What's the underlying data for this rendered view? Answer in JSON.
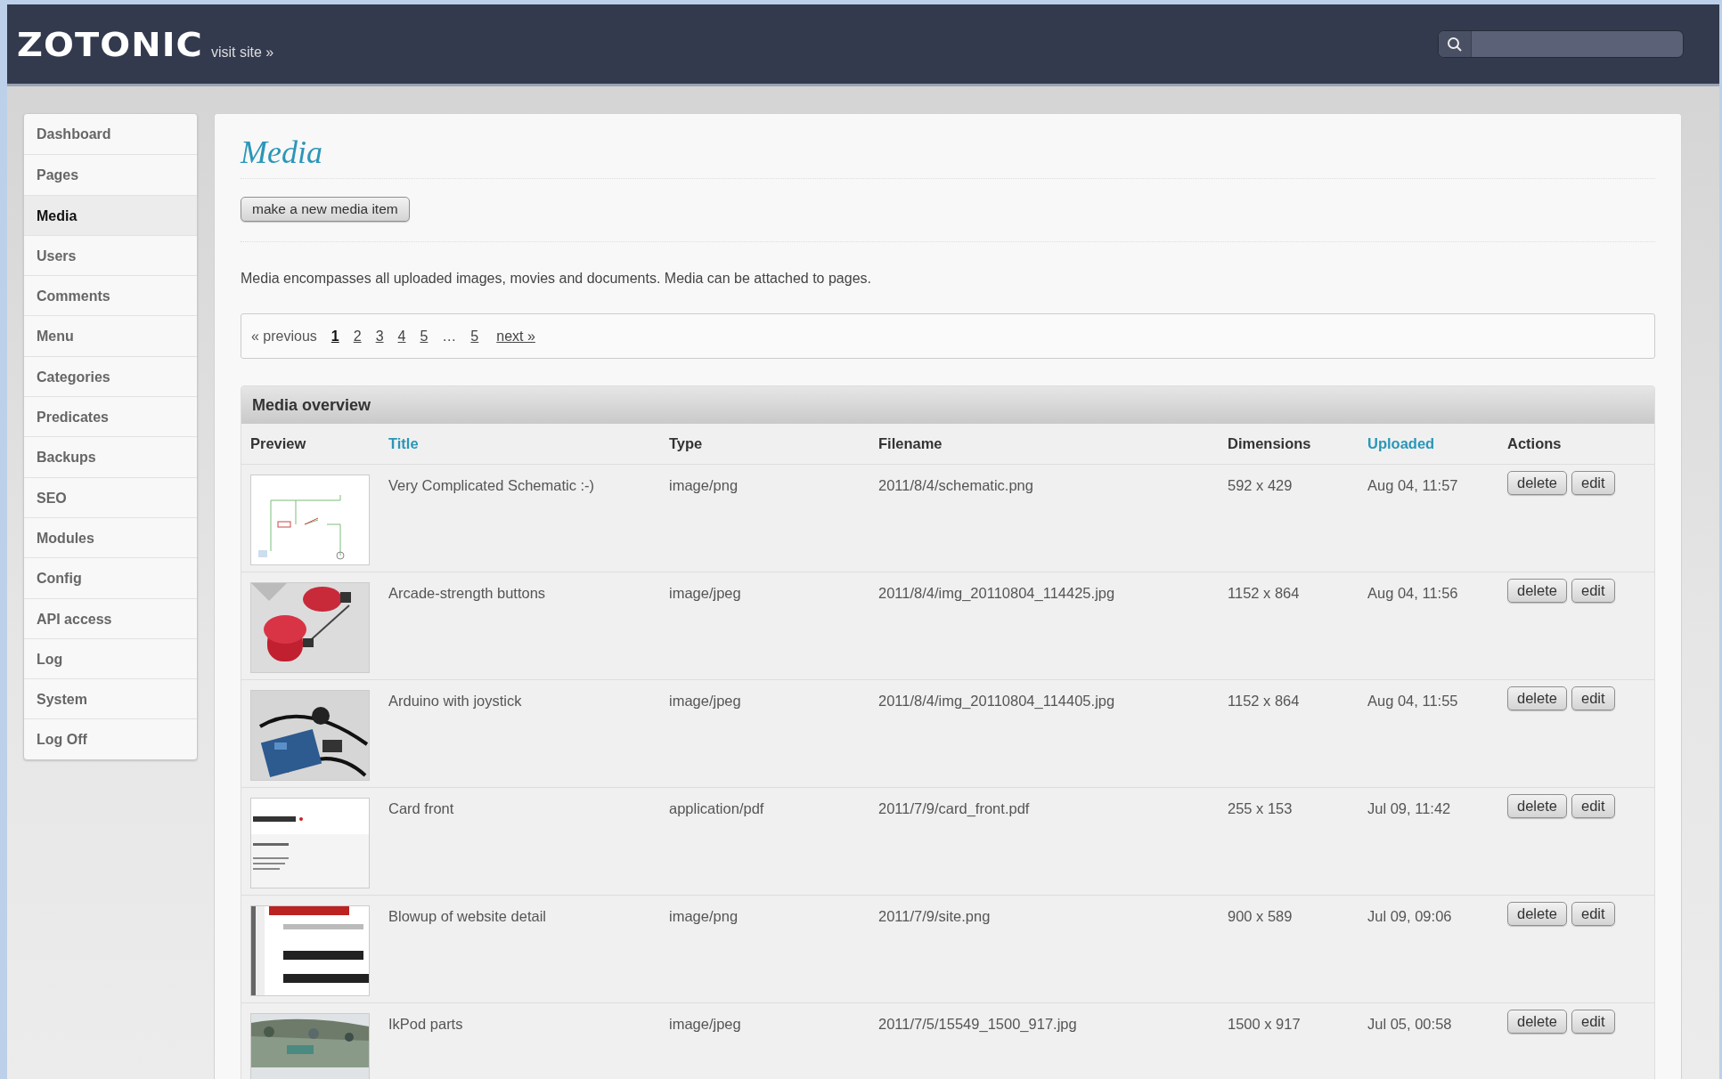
{
  "header": {
    "logo": "ZOTONIC",
    "visit_link": "visit site »"
  },
  "sidebar": {
    "items": [
      {
        "label": "Dashboard",
        "selected": false
      },
      {
        "label": "Pages",
        "selected": false
      },
      {
        "label": "Media",
        "selected": true
      },
      {
        "label": "Users",
        "selected": false
      },
      {
        "label": "Comments",
        "selected": false
      },
      {
        "label": "Menu",
        "selected": false
      },
      {
        "label": "Categories",
        "selected": false
      },
      {
        "label": "Predicates",
        "selected": false
      },
      {
        "label": "Backups",
        "selected": false
      },
      {
        "label": "SEO",
        "selected": false
      },
      {
        "label": "Modules",
        "selected": false
      },
      {
        "label": "Config",
        "selected": false
      },
      {
        "label": "API access",
        "selected": false
      },
      {
        "label": "Log",
        "selected": false
      },
      {
        "label": "System",
        "selected": false
      },
      {
        "label": "Log Off",
        "selected": false
      }
    ]
  },
  "page": {
    "title": "Media",
    "new_button": "make a new media item",
    "description": "Media encompasses all uploaded images, movies and documents. Media can be attached to pages."
  },
  "pagination": {
    "previous": {
      "label": "« previous",
      "disabled": true
    },
    "items": [
      {
        "kind": "page",
        "label": "1",
        "selected": true
      },
      {
        "kind": "page",
        "label": "2",
        "selected": false
      },
      {
        "kind": "page",
        "label": "3",
        "selected": false
      },
      {
        "kind": "page",
        "label": "4",
        "selected": false
      },
      {
        "kind": "page",
        "label": "5",
        "selected": false
      },
      {
        "kind": "ellipsis",
        "label": "…"
      },
      {
        "kind": "page",
        "label": "5",
        "selected": false
      }
    ],
    "next": {
      "label": "next »",
      "disabled": false
    }
  },
  "table": {
    "title": "Media overview",
    "columns": [
      {
        "label": "Preview",
        "sortable": false
      },
      {
        "label": "Title",
        "sortable": true
      },
      {
        "label": "Type",
        "sortable": false
      },
      {
        "label": "Filename",
        "sortable": false
      },
      {
        "label": "Dimensions",
        "sortable": false
      },
      {
        "label": "Uploaded",
        "sortable": true
      },
      {
        "label": "Actions",
        "sortable": false
      }
    ],
    "rows": [
      {
        "title": "Very Complicated Schematic :-)",
        "type": "image/png",
        "filename": "2011/8/4/schematic.png",
        "dimensions": "592 x 429",
        "uploaded": "Aug 04, 11:57",
        "actions": [
          "delete",
          "edit"
        ]
      },
      {
        "title": "Arcade-strength buttons",
        "type": "image/jpeg",
        "filename": "2011/8/4/img_20110804_114425.jpg",
        "dimensions": "1152 x 864",
        "uploaded": "Aug 04, 11:56",
        "actions": [
          "delete",
          "edit"
        ]
      },
      {
        "title": "Arduino with joystick",
        "type": "image/jpeg",
        "filename": "2011/8/4/img_20110804_114405.jpg",
        "dimensions": "1152 x 864",
        "uploaded": "Aug 04, 11:55",
        "actions": [
          "delete",
          "edit"
        ]
      },
      {
        "title": "Card front",
        "type": "application/pdf",
        "filename": "2011/7/9/card_front.pdf",
        "dimensions": "255 x 153",
        "uploaded": "Jul 09, 11:42",
        "actions": [
          "delete",
          "edit"
        ]
      },
      {
        "title": "Blowup of website detail",
        "type": "image/png",
        "filename": "2011/7/9/site.png",
        "dimensions": "900 x 589",
        "uploaded": "Jul 09, 09:06",
        "actions": [
          "delete",
          "edit"
        ]
      },
      {
        "title": "IkPod parts",
        "type": "image/jpeg",
        "filename": "2011/7/5/15549_1500_917.jpg",
        "dimensions": "1500 x 917",
        "uploaded": "Jul 05, 00:58",
        "actions": [
          "delete",
          "edit"
        ]
      }
    ]
  }
}
